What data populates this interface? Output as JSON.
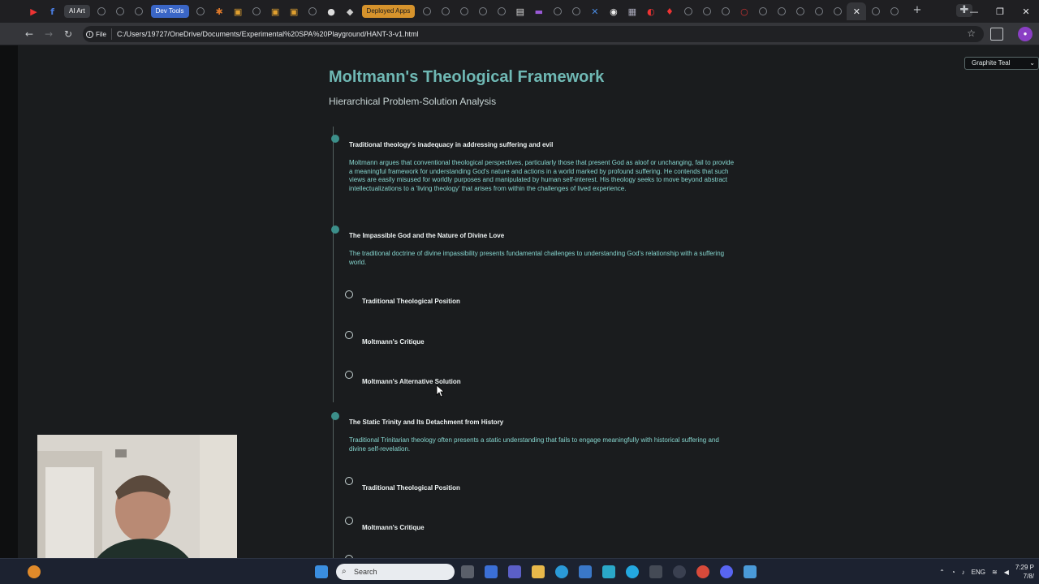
{
  "browser": {
    "tab_labels": {
      "ai_art": "AI Art",
      "dev_tools": "Dev Tools",
      "deployed_apps": "Deployed Apps"
    },
    "file_chip": "File",
    "url": "C:/Users/19727/OneDrive/Documents/Experimental%20SPA%20Playground/HANT-3-v1.html"
  },
  "theme_selector": {
    "selected": "Graphite Teal"
  },
  "page": {
    "title": "Moltmann's Theological Framework",
    "subtitle": "Hierarchical Problem-Solution Analysis"
  },
  "nodes": [
    {
      "title": "Traditional theology's inadequacy in addressing suffering and evil",
      "description": "Moltmann argues that conventional theological perspectives, particularly those that present God as aloof or unchanging, fail to provide a meaningful framework for understanding God's nature and actions in a world marked by profound suffering. He contends that such views are easily misused for worldly purposes and manipulated by human self-interest. His theology seeks to move beyond abstract intellectualizations to a 'living theology' that arises from within the challenges of lived experience."
    },
    {
      "title": "The Impassible God and the Nature of Divine Love",
      "description": "The traditional doctrine of divine impassibility presents fundamental challenges to understanding God's relationship with a suffering world.",
      "subitems": [
        "Traditional Theological Position",
        "Moltmann's Critique",
        "Moltmann's Alternative Solution"
      ]
    },
    {
      "title": "The Static Trinity and Its Detachment from History",
      "description": "Traditional Trinitarian theology often presents a static understanding that fails to engage meaningfully with historical suffering and divine self-revelation.",
      "subitems": [
        "Traditional Theological Position",
        "Moltmann's Critique"
      ]
    }
  ],
  "taskbar": {
    "search_placeholder": "Search",
    "language": "ENG",
    "time": "7:29 P",
    "date": "7/8/"
  }
}
